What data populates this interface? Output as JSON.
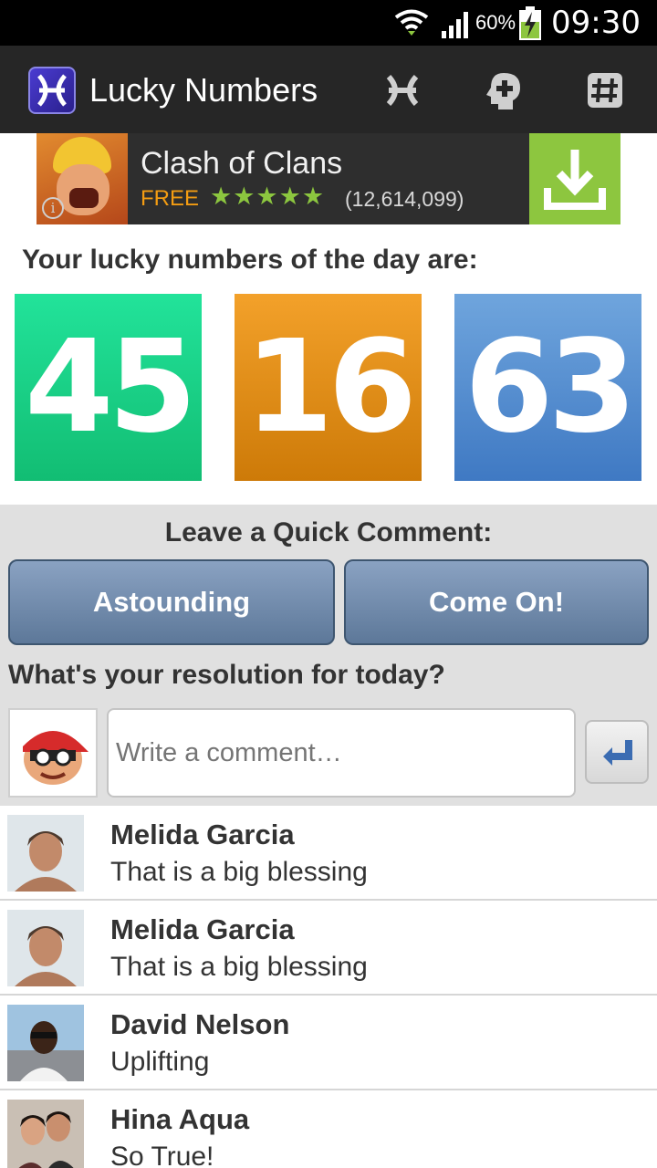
{
  "status_bar": {
    "battery_percent": "60%",
    "time": "09:30"
  },
  "action_bar": {
    "title": "Lucky Numbers",
    "icons": [
      "pisces-icon",
      "head-plus-icon",
      "hash-icon"
    ]
  },
  "ad": {
    "title": "Clash of Clans",
    "price": "FREE",
    "stars": "★★★★★",
    "rating": 4.5,
    "review_count": "(12,614,099)",
    "info_glyph": "i"
  },
  "lucky": {
    "heading": "Your lucky numbers of the day are:",
    "numbers": [
      "45",
      "16",
      "63"
    ],
    "colors": [
      "#1ed98b",
      "#e98f1a",
      "#5b92d2"
    ]
  },
  "quick_comment": {
    "heading": "Leave a Quick Comment:",
    "button_left": "Astounding",
    "button_right": "Come On!"
  },
  "resolution": {
    "heading": "What's your resolution for today?",
    "placeholder": "Write a comment…"
  },
  "comments": [
    {
      "name": "Melida Garcia",
      "text": "That is a big blessing"
    },
    {
      "name": "Melida Garcia",
      "text": "That is a big blessing"
    },
    {
      "name": "David Nelson",
      "text": "Uplifting"
    },
    {
      "name": "Hina Aqua",
      "text": "So True!"
    }
  ],
  "colors": {
    "accent_green": "#8dc63f",
    "ad_free": "#f39c12",
    "button_blue": "#6f89ab"
  }
}
